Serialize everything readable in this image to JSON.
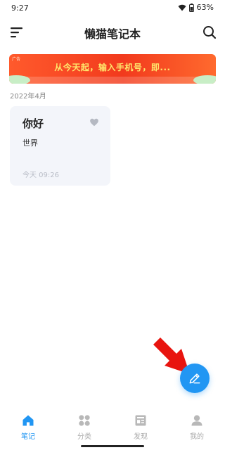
{
  "status": {
    "time": "9:27",
    "battery": "63%"
  },
  "header": {
    "title": "懒猫笔记本"
  },
  "ad": {
    "label": "广告",
    "text": "从今天起，输入手机号，即..."
  },
  "notes_section": {
    "month": "2022年4月"
  },
  "notes": [
    {
      "title": "你好",
      "body": "世界",
      "time": "今天  09:26"
    }
  ],
  "tabs": [
    {
      "label": "笔记",
      "icon": "home-icon",
      "active": true
    },
    {
      "label": "分类",
      "icon": "grid-icon",
      "active": false
    },
    {
      "label": "发现",
      "icon": "newspaper-icon",
      "active": false
    },
    {
      "label": "我的",
      "icon": "person-icon",
      "active": false
    }
  ],
  "colors": {
    "accent": "#2196f3",
    "ad_bg": "#f23a1d",
    "annotation_arrow": "#e8140f",
    "card_bg": "#f3f5fa"
  }
}
